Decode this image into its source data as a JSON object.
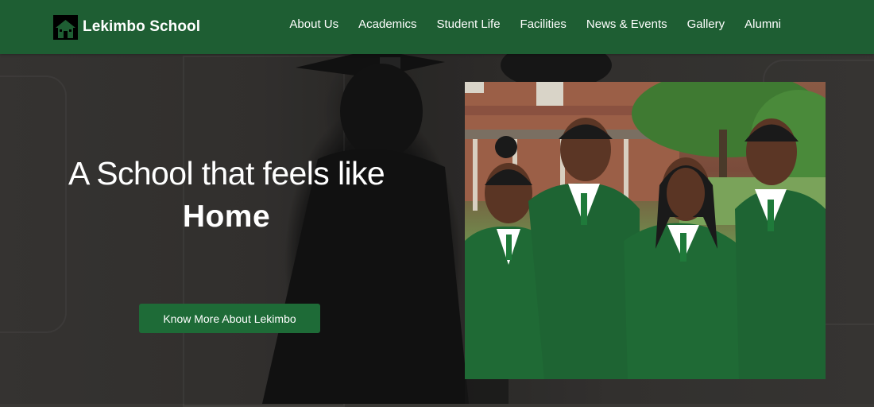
{
  "brand": {
    "name": "Lekimbo School",
    "logo_icon": "school-house-icon"
  },
  "nav": {
    "items": [
      "About Us",
      "Academics",
      "Student Life",
      "Facilities",
      "News & Events",
      "Gallery",
      "Alumni"
    ]
  },
  "hero": {
    "title_line1": "A School that feels like",
    "title_line2": "Home",
    "cta_label": "Know More About Lekimbo"
  },
  "colors": {
    "header_bg": "#1e5e33",
    "cta_bg": "#1e6b37",
    "uniform_green": "#1f6a35",
    "text": "#ffffff"
  }
}
